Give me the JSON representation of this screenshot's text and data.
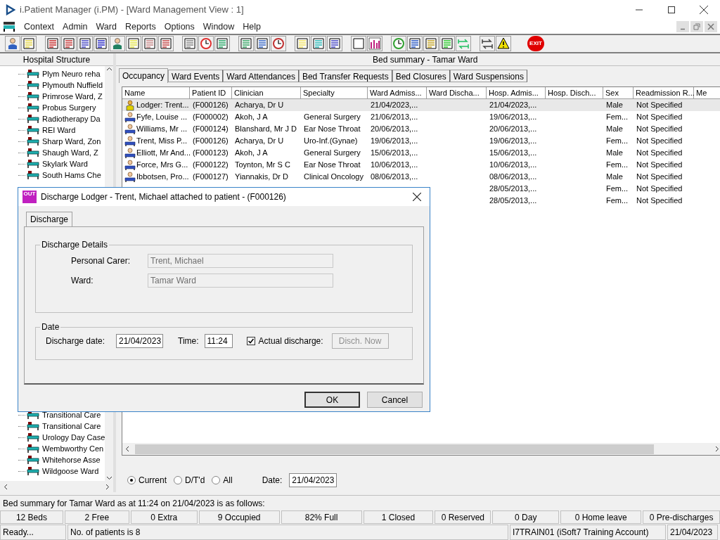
{
  "window": {
    "title": "i.Patient Manager (i.PM) - [Ward Management View : 1]"
  },
  "menu": [
    "Context",
    "Admin",
    "Ward",
    "Reports",
    "Options",
    "Window",
    "Help"
  ],
  "toolbar": {
    "exit_label": "EXIT"
  },
  "left_pane": {
    "header": "Hospital Structure",
    "items_top": [
      "Plym Neuro reha",
      "Plymouth Nuffield",
      "Primrose Ward, Z",
      "Probus Surgery",
      "Radiotherapy Da",
      "REI Ward",
      "Sharp Ward, Zon",
      "Shaugh Ward, Z",
      "Skylark Ward",
      "South Hams Che"
    ],
    "items_bottom": [
      "Transitional Care",
      "Transitional Care",
      "Urology Day Case",
      "Wembworthy Cen",
      "Whitehorse Asse",
      "Wildgoose Ward"
    ]
  },
  "right_pane": {
    "header": "Bed summary - Tamar Ward",
    "tabs": [
      {
        "label": "Occupancy",
        "selected": true
      },
      {
        "label": "Ward Events",
        "selected": false
      },
      {
        "label": "Ward Attendances",
        "selected": false
      },
      {
        "label": "Bed Transfer Requests",
        "selected": false
      },
      {
        "label": "Bed Closures",
        "selected": false
      },
      {
        "label": "Ward Suspensions",
        "selected": false
      }
    ],
    "table": {
      "columns": [
        "Name",
        "Patient ID",
        "Clinician",
        "Specialty",
        "Ward Admiss...",
        "Ward Discha...",
        "Hosp. Admis...",
        "Hosp. Disch...",
        "Sex",
        "Readmission R...",
        "Me"
      ],
      "rows": [
        {
          "kind": "lodger",
          "selected": true,
          "cells": [
            "Lodger: Trent...",
            "(F000126)",
            "Acharya, Dr U",
            null,
            "21/04/2023,...",
            null,
            "21/04/2023,...",
            null,
            "Male",
            "Not Specified",
            null
          ]
        },
        {
          "kind": "patient",
          "selected": false,
          "cells": [
            "Fyfe, Louise ...",
            "(F000002)",
            "Akoh, J A",
            "General Surgery",
            "21/06/2013,...",
            null,
            "19/06/2013,...",
            null,
            "Fem...",
            "Not Specified",
            null
          ]
        },
        {
          "kind": "patient",
          "selected": false,
          "cells": [
            "Williams, Mr ...",
            "(F000124)",
            "Blanshard, Mr J D",
            "Ear Nose Throat",
            "20/06/2013,...",
            null,
            "20/06/2013,...",
            null,
            "Male",
            "Not Specified",
            null
          ]
        },
        {
          "kind": "patient",
          "selected": false,
          "cells": [
            "Trent, Miss P...",
            "(F000126)",
            "Acharya, Dr U",
            "Uro-Inf.(Gynae)",
            "19/06/2013,...",
            null,
            "19/06/2013,...",
            null,
            "Fem...",
            "Not Specified",
            null
          ]
        },
        {
          "kind": "patient",
          "selected": false,
          "cells": [
            "Elliott, Mr And...",
            "(F000123)",
            "Akoh, J A",
            "General Surgery",
            "15/06/2013,...",
            null,
            "15/06/2013,...",
            null,
            "Male",
            "Not Specified",
            null
          ]
        },
        {
          "kind": "patient",
          "selected": false,
          "cells": [
            "Force, Mrs G...",
            "(F000122)",
            "Toynton, Mr S C",
            "Ear Nose Throat",
            "10/06/2013,...",
            null,
            "10/06/2013,...",
            null,
            "Fem...",
            "Not Specified",
            null
          ]
        },
        {
          "kind": "patient",
          "selected": false,
          "cells": [
            "Ibbotsen, Pro...",
            "(F000127)",
            "Yiannakis, Dr D",
            "Clinical Oncology",
            "08/06/2013,...",
            null,
            "08/06/2013,...",
            null,
            "Male",
            "Not Specified",
            null
          ]
        },
        {
          "kind": "covered",
          "selected": false,
          "cells": [
            null,
            null,
            null,
            null,
            null,
            null,
            "28/05/2013,...",
            null,
            "Fem...",
            "Not Specified",
            null
          ]
        },
        {
          "kind": "covered",
          "selected": false,
          "cells": [
            null,
            null,
            null,
            null,
            null,
            null,
            "28/05/2013,...",
            null,
            "Fem...",
            "Not Specified",
            null
          ]
        }
      ]
    },
    "filter": {
      "options": [
        {
          "label": "Current",
          "selected": true
        },
        {
          "label": "D/T'd",
          "selected": false
        },
        {
          "label": "All",
          "selected": false
        }
      ],
      "date_label": "Date:",
      "date": "21/04/2023"
    }
  },
  "summary_text": "Bed summary for Tamar Ward as at 11:24 on 21/04/2023 is as follows:",
  "stats": [
    "12 Beds",
    "2 Free",
    "0 Extra",
    "9 Occupied",
    "82% Full",
    "1 Closed",
    "0 Reserved",
    "0 Day",
    "0 Home leave",
    "0 Pre-discharges"
  ],
  "status_bar": [
    "Ready...",
    "No. of patients is 8",
    "I7TRAIN01 (iSoft7 Training Account)",
    "21/04/2023"
  ],
  "dialog": {
    "title": "Discharge Lodger - Trent, Michael attached to patient - (F000126)",
    "icon_label": "OUT",
    "tab": {
      "label": "Discharge",
      "selected": true
    },
    "details": {
      "legend": "Discharge Details",
      "fields": [
        {
          "label": "Personal Carer:",
          "value": "Trent, Michael",
          "disabled": true
        },
        {
          "label": "Ward:",
          "value": "Tamar Ward",
          "disabled": true
        }
      ]
    },
    "date": {
      "legend": "Date",
      "date_label": "Discharge date:",
      "date": "21/04/2023",
      "time_label": "Time:",
      "time": "11:24",
      "actual_label": "Actual discharge:",
      "actual_checked": true,
      "now_button": {
        "label": "Disch. Now",
        "disabled": true
      }
    },
    "buttons": [
      "OK",
      "Cancel"
    ]
  }
}
